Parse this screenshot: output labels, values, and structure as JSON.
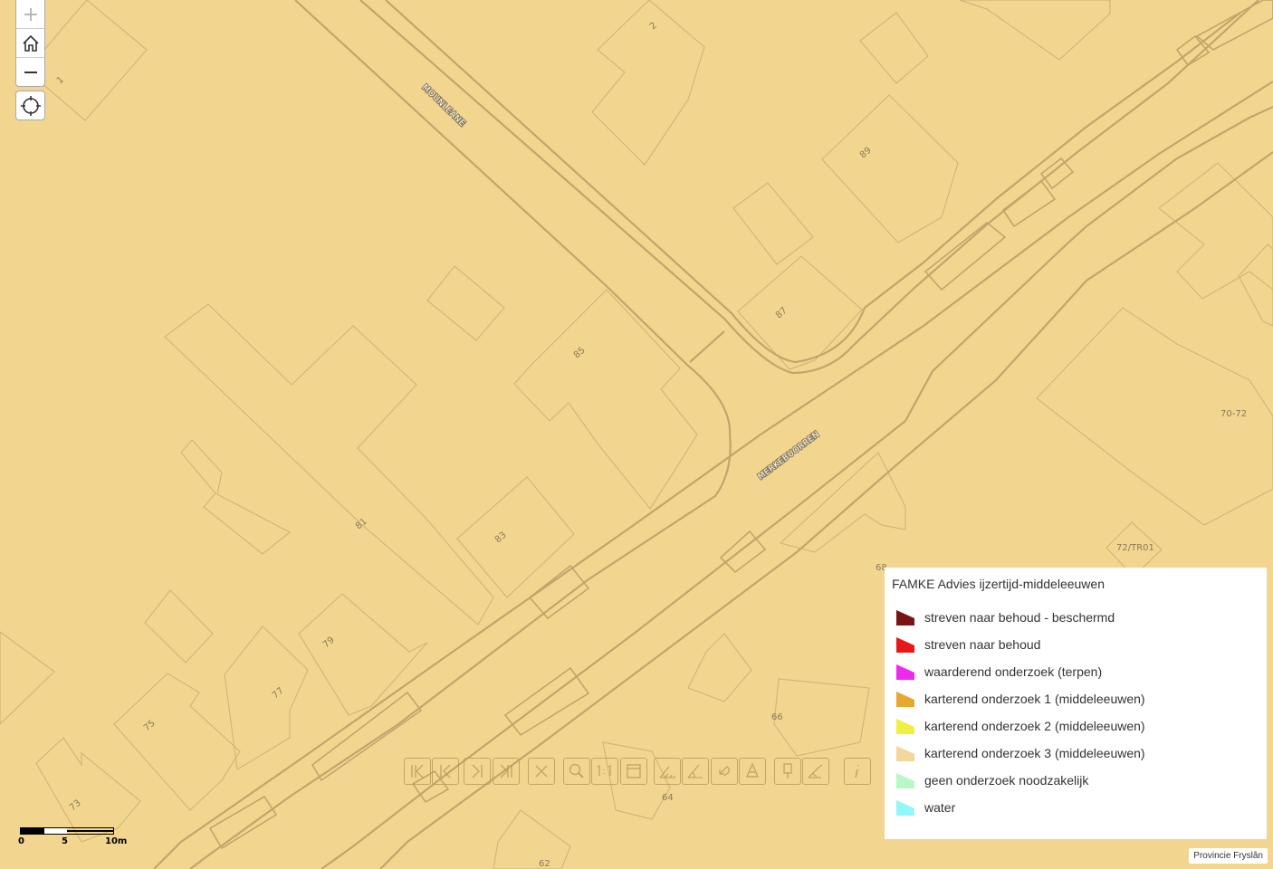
{
  "map": {
    "parcel_labels": [
      "1",
      "2",
      "89",
      "87",
      "85",
      "81",
      "83",
      "79",
      "77",
      "75",
      "73",
      "68",
      "66",
      "64",
      "62",
      "70-72",
      "72/TR01"
    ],
    "street_labels": [
      "MOUNLEANE",
      "MERKEBUORREN"
    ]
  },
  "controls": {
    "zoom_in_icon": "plus-icon",
    "home_icon": "home-icon",
    "zoom_out_icon": "minus-icon",
    "locate_icon": "crosshair-icon"
  },
  "toolbar": {
    "tools": [
      "first-extent-icon",
      "previous-extent-icon",
      "next-extent-icon",
      "last-extent-icon",
      "clear-icon",
      "zoom-icon",
      "one-to-one-icon",
      "full-extent-icon",
      "measure-area-icon",
      "measure-angle-icon",
      "undo-icon",
      "cone-icon",
      "marker-icon",
      "draw-icon",
      "info-icon"
    ]
  },
  "scalebar": {
    "labels": [
      "0",
      "5",
      "10m"
    ]
  },
  "legend": {
    "title": "FAMKE Advies ijzertijd-middeleeuwen",
    "items": [
      {
        "label": "streven naar behoud - beschermd",
        "color": "#7a1414"
      },
      {
        "label": "streven naar behoud",
        "color": "#e81818"
      },
      {
        "label": "waarderend onderzoek (terpen)",
        "color": "#f028f0"
      },
      {
        "label": "karterend onderzoek 1 (middeleeuwen)",
        "color": "#e8a830"
      },
      {
        "label": "karterend onderzoek 2 (middeleeuwen)",
        "color": "#f0f040"
      },
      {
        "label": "karterend onderzoek 3 (middeleeuwen)",
        "color": "#f2d69a"
      },
      {
        "label": "geen onderzoek noodzakelijk",
        "color": "#b8f8c8"
      },
      {
        "label": "water",
        "color": "#90f8f8"
      }
    ]
  },
  "attribution": "Provincie Fryslân",
  "colors": {
    "map_fill": "#f2d690",
    "parcel_line": "#d8bc80",
    "road_line": "#c4a46a"
  }
}
